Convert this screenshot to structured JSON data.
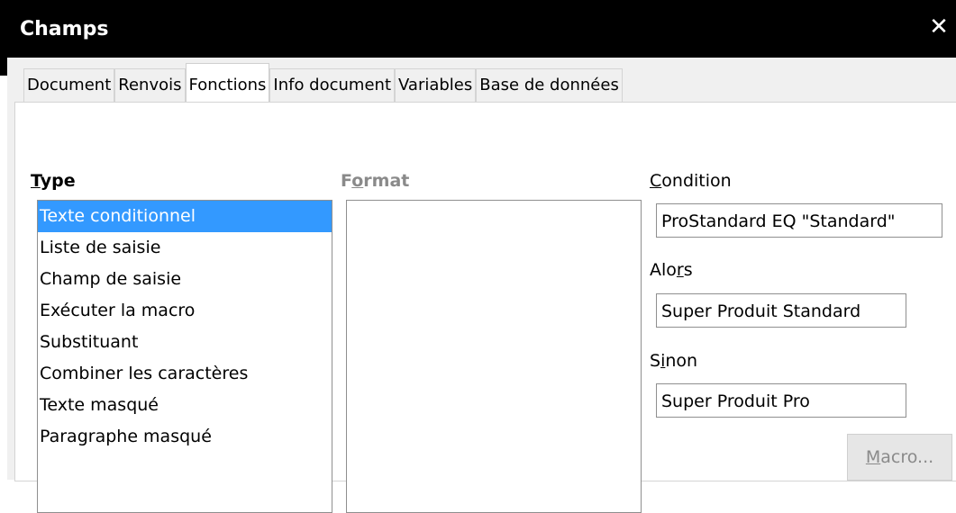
{
  "window": {
    "title": "Champs",
    "close_glyph": "✕"
  },
  "tabs": [
    {
      "label": "Document",
      "active": false
    },
    {
      "label": "Renvois",
      "active": false
    },
    {
      "label": "Fonctions",
      "active": true
    },
    {
      "label": "Info document",
      "active": false
    },
    {
      "label": "Variables",
      "active": false
    },
    {
      "label": "Base de données",
      "active": false
    }
  ],
  "type_section": {
    "label_prefix": "",
    "label_mnemonic": "T",
    "label_rest": "ype",
    "items": [
      "Texte conditionnel",
      "Liste de saisie",
      "Champ de saisie",
      "Exécuter la macro",
      "Substituant",
      "Combiner les caractères",
      "Texte masqué",
      "Paragraphe masqué"
    ],
    "selected_index": 0
  },
  "format_section": {
    "label_prefix": "F",
    "label_mnemonic": "o",
    "label_rest": "rmat",
    "items": []
  },
  "condition": {
    "label_prefix": "",
    "label_mnemonic": "C",
    "label_rest": "ondition",
    "value": "ProStandard EQ \"Standard\""
  },
  "then": {
    "label_prefix": "Alo",
    "label_mnemonic": "r",
    "label_rest": "s",
    "value": "Super Produit Standard"
  },
  "else": {
    "label_prefix": "S",
    "label_mnemonic": "i",
    "label_rest": "non",
    "value": "Super Produit Pro"
  },
  "macro_button": {
    "label_prefix": "",
    "label_mnemonic": "M",
    "label_rest": "acro..."
  },
  "colors": {
    "titlebar_bg": "#000000",
    "selection_bg": "#3399ff",
    "disabled_text": "#8a8a8a"
  }
}
